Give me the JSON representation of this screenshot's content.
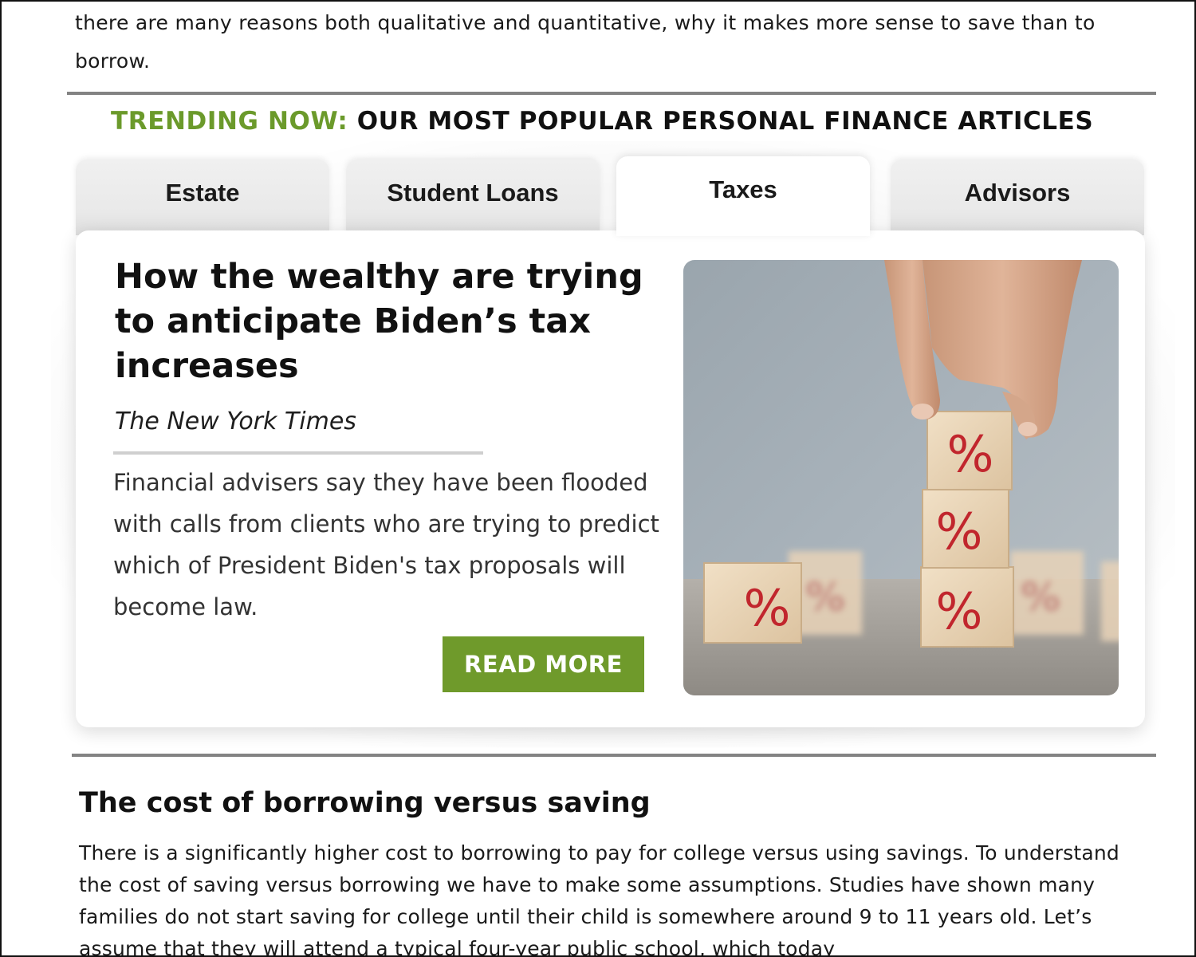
{
  "intro": {
    "text": "there are many reasons both qualitative and quantitative, why it makes more sense to save than to borrow."
  },
  "trending": {
    "prefix": "TRENDING NOW:",
    "title": "OUR MOST POPULAR PERSONAL FINANCE ARTICLES",
    "accent_color": "#6b9a2b"
  },
  "tabs": [
    {
      "label": "Estate",
      "active": false
    },
    {
      "label": "Student Loans",
      "active": false
    },
    {
      "label": "Taxes",
      "active": true
    },
    {
      "label": "Advisors",
      "active": false
    }
  ],
  "article": {
    "headline": "How the wealthy are trying to anticipate Biden’s tax increases",
    "source": "The New York Times",
    "summary": "Financial advisers say they have been flooded with calls from clients who are trying to predict which of President Biden's tax proposals will become law.",
    "button_label": "READ MORE",
    "button_color": "#6f9a2b",
    "image_icon": "percent-blocks-image",
    "block_symbol": "%"
  },
  "section": {
    "title": "The cost of borrowing versus saving",
    "body": "There is a significantly higher cost to borrowing to pay for college versus using savings. To understand the cost of saving versus borrowing we have to make some assumptions. Studies have shown many families do not start saving for college until their child is somewhere around 9 to 11 years old. Let’s assume that they will attend a typical four-year public school, which today"
  }
}
